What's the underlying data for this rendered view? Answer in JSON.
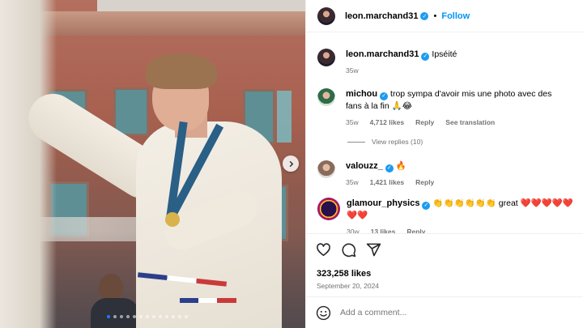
{
  "header": {
    "username": "leon.marchand31",
    "separator": "•",
    "follow_label": "Follow"
  },
  "caption": {
    "username": "leon.marchand31",
    "text": "Ipséité",
    "time": "35w"
  },
  "comments": [
    {
      "username": "michou",
      "text": "trop sympa d'avoir mis une photo avec des fans à la fin 🙏😂",
      "time": "35w",
      "likes": "4,712 likes",
      "reply": "Reply",
      "translate": "See translation",
      "view_replies": "View replies (10)"
    },
    {
      "username": "valouzz_",
      "text": "🔥",
      "time": "35w",
      "likes": "1,421 likes",
      "reply": "Reply"
    },
    {
      "username": "glamour_physics",
      "text": "👏👏👏👏👏👏 great ❤️❤️❤️❤️❤️❤️❤️",
      "time": "30w",
      "likes": "13 likes",
      "reply": "Reply"
    }
  ],
  "post": {
    "likes": "323,258 likes",
    "date": "September 20, 2024"
  },
  "composer": {
    "placeholder": "Add a comment..."
  },
  "carousel": {
    "slide_count": 13,
    "active_index": 0
  },
  "colors": {
    "accent": "#0095f6",
    "verified": "#1d9bf0",
    "muted": "#737373"
  }
}
